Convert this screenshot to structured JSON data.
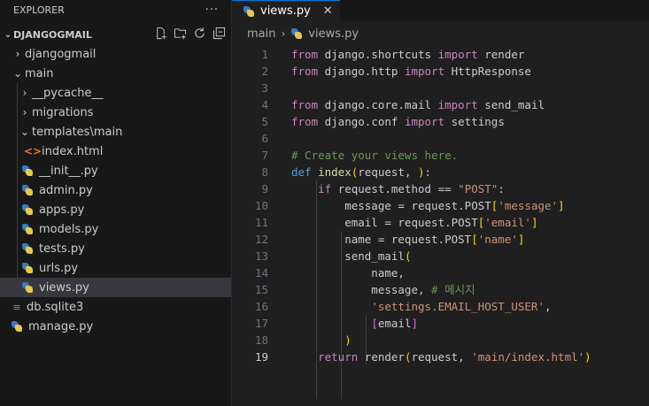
{
  "explorer": {
    "title": "EXPLORER",
    "more_label": "···",
    "workspace": "DJANGOGMAIL",
    "items": [
      {
        "label": "djangogmail"
      },
      {
        "label": "main"
      },
      {
        "label": "__pycache__"
      },
      {
        "label": "migrations"
      },
      {
        "label": "templates\\main"
      },
      {
        "label": "index.html"
      },
      {
        "label": "__init__.py"
      },
      {
        "label": "admin.py"
      },
      {
        "label": "apps.py"
      },
      {
        "label": "models.py"
      },
      {
        "label": "tests.py"
      },
      {
        "label": "urls.py"
      },
      {
        "label": "views.py"
      },
      {
        "label": "db.sqlite3"
      },
      {
        "label": "manage.py"
      }
    ]
  },
  "editor": {
    "tab_label": "views.py",
    "breadcrumb": [
      "main",
      "views.py"
    ],
    "active_line": 19,
    "lines": [
      [
        {
          "t": "from",
          "c": "ctrl"
        },
        {
          "t": " django.shortcuts ",
          "c": ""
        },
        {
          "t": "import",
          "c": "ctrl"
        },
        {
          "t": " render",
          "c": ""
        }
      ],
      [
        {
          "t": "from",
          "c": "ctrl"
        },
        {
          "t": " django.http ",
          "c": ""
        },
        {
          "t": "import",
          "c": "ctrl"
        },
        {
          "t": " HttpResponse",
          "c": ""
        }
      ],
      [],
      [
        {
          "t": "from",
          "c": "ctrl"
        },
        {
          "t": " django.core.mail ",
          "c": ""
        },
        {
          "t": "import",
          "c": "ctrl"
        },
        {
          "t": " send_mail",
          "c": ""
        }
      ],
      [
        {
          "t": "from",
          "c": "ctrl"
        },
        {
          "t": " django.conf ",
          "c": ""
        },
        {
          "t": "import",
          "c": "ctrl"
        },
        {
          "t": " settings",
          "c": ""
        }
      ],
      [],
      [
        {
          "t": "# Create your views here.",
          "c": "cmt"
        }
      ],
      [
        {
          "t": "def",
          "c": "kw"
        },
        {
          "t": " ",
          "c": ""
        },
        {
          "t": "index",
          "c": "fn"
        },
        {
          "t": "(",
          "c": "brk1"
        },
        {
          "t": "request, ",
          "c": ""
        },
        {
          "t": ")",
          "c": "brk1"
        },
        {
          "t": ":",
          "c": ""
        }
      ],
      [
        {
          "t": "    ",
          "c": ""
        },
        {
          "t": "if",
          "c": "ctrl"
        },
        {
          "t": " request.method == ",
          "c": ""
        },
        {
          "t": "\"POST\"",
          "c": "str"
        },
        {
          "t": ":",
          "c": ""
        }
      ],
      [
        {
          "t": "        message = request.POST",
          "c": ""
        },
        {
          "t": "[",
          "c": "brk1"
        },
        {
          "t": "'message'",
          "c": "str"
        },
        {
          "t": "]",
          "c": "brk1"
        }
      ],
      [
        {
          "t": "        email = request.POST",
          "c": ""
        },
        {
          "t": "[",
          "c": "brk1"
        },
        {
          "t": "'email'",
          "c": "str"
        },
        {
          "t": "]",
          "c": "brk1"
        }
      ],
      [
        {
          "t": "        name = request.POST",
          "c": ""
        },
        {
          "t": "[",
          "c": "brk1"
        },
        {
          "t": "'name'",
          "c": "str"
        },
        {
          "t": "]",
          "c": "brk1"
        }
      ],
      [
        {
          "t": "        send_mail",
          "c": ""
        },
        {
          "t": "(",
          "c": "brk1"
        }
      ],
      [
        {
          "t": "            name,",
          "c": ""
        }
      ],
      [
        {
          "t": "            message, ",
          "c": ""
        },
        {
          "t": "# 메시지",
          "c": "cmt"
        }
      ],
      [
        {
          "t": "            ",
          "c": ""
        },
        {
          "t": "'settings.EMAIL_HOST_USER'",
          "c": "str"
        },
        {
          "t": ",",
          "c": ""
        }
      ],
      [
        {
          "t": "            ",
          "c": ""
        },
        {
          "t": "[",
          "c": "brk2"
        },
        {
          "t": "email",
          "c": ""
        },
        {
          "t": "]",
          "c": "brk2"
        }
      ],
      [
        {
          "t": "        ",
          "c": ""
        },
        {
          "t": ")",
          "c": "brk1"
        }
      ],
      [
        {
          "t": "    ",
          "c": ""
        },
        {
          "t": "return",
          "c": "ctrl"
        },
        {
          "t": " render",
          "c": ""
        },
        {
          "t": "(",
          "c": "brk1"
        },
        {
          "t": "request, ",
          "c": ""
        },
        {
          "t": "'main/index.html'",
          "c": "str"
        },
        {
          "t": ")",
          "c": "brk1"
        }
      ]
    ]
  }
}
